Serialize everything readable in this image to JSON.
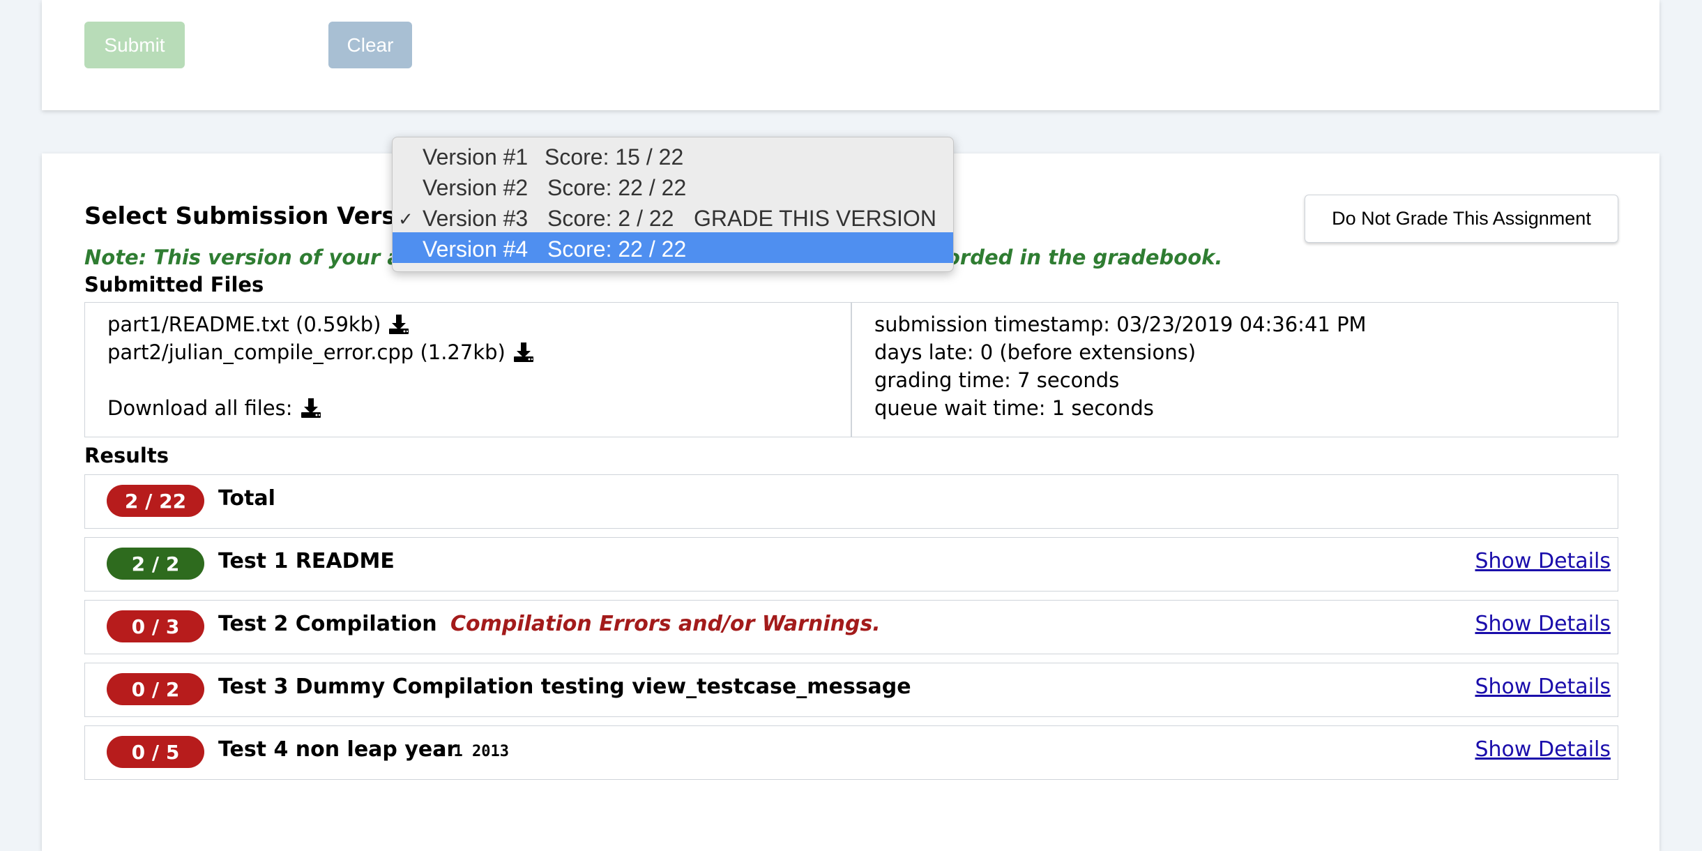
{
  "top_form": {
    "submit_label": "Submit",
    "clear_label": "Clear"
  },
  "version_select": {
    "label": "Select Submission Version:",
    "options": [
      {
        "version": "Version #1",
        "score": "Score: 15 / 22",
        "tag": "",
        "checked": false,
        "highlighted": false
      },
      {
        "version": "Version #2",
        "score": "Score: 22 / 22",
        "tag": "",
        "checked": false,
        "highlighted": false
      },
      {
        "version": "Version #3",
        "score": "Score: 2 / 22",
        "tag": "GRADE THIS VERSION",
        "checked": true,
        "highlighted": false
      },
      {
        "version": "Version #4",
        "score": "Score: 22 / 22",
        "tag": "",
        "checked": false,
        "highlighted": true
      }
    ],
    "check_mark": "✓"
  },
  "note": {
    "visible_start": "Note: This version of your assign",
    "visible_end": "orded in the gradebook."
  },
  "do_not_grade_label": "Do Not Grade This Assignment",
  "submitted_files": {
    "heading": "Submitted Files",
    "files": [
      "part1/README.txt (0.59kb)",
      "part2/julian_compile_error.cpp (1.27kb)"
    ],
    "download_all_label": "Download all files:"
  },
  "submission_info": {
    "timestamp": "submission timestamp: 03/23/2019 04:36:41 PM",
    "days_late": "days late: 0 (before extensions)",
    "grading_time": "grading time: 7 seconds",
    "queue_wait": "queue wait time: 1 seconds"
  },
  "results": {
    "heading": "Results",
    "total": {
      "score": "2 / 22",
      "label": "Total",
      "status": "fail"
    },
    "tests": [
      {
        "score": "2 / 2",
        "title": "Test 1 README",
        "extra": "",
        "mono": "",
        "status": "pass",
        "details": "Show Details"
      },
      {
        "score": "0 / 3",
        "title": "Test 2 Compilation",
        "extra": "Compilation Errors and/or Warnings.",
        "mono": "",
        "status": "fail",
        "details": "Show Details"
      },
      {
        "score": "0 / 2",
        "title": "Test 3 Dummy Compilation testing view_testcase_message",
        "extra": "",
        "mono": "",
        "status": "fail",
        "details": "Show Details"
      },
      {
        "score": "0 / 5",
        "title": "Test 4 non leap year",
        "extra": "",
        "mono": "3  1  2013",
        "status": "fail",
        "details": "Show Details"
      }
    ]
  },
  "colors": {
    "pass": "#2e6b1e",
    "fail": "#b71c1c",
    "note": "#2f7d32",
    "link": "#1a0dab",
    "highlight": "#4f8ff0"
  },
  "icons": {
    "download": "download-icon"
  }
}
